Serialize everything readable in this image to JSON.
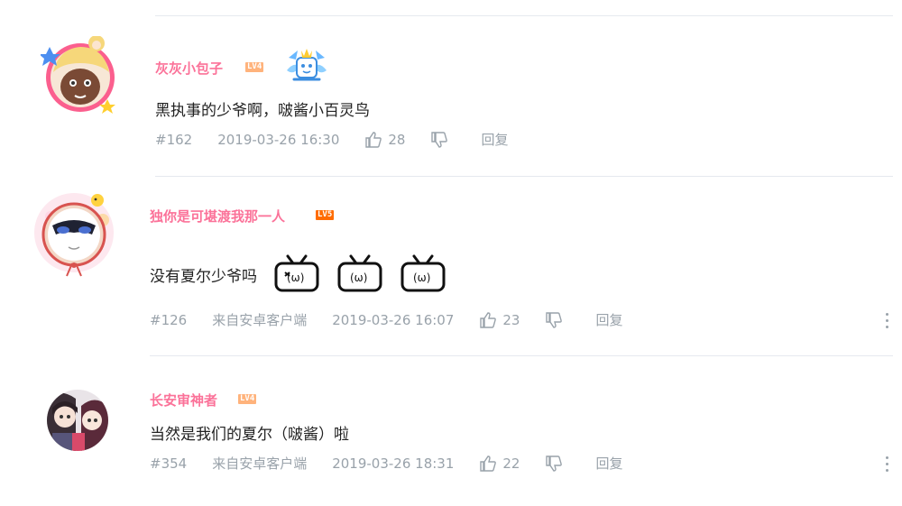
{
  "comments": [
    {
      "username": "灰灰小包子",
      "level": "LV4",
      "text": "黑执事的少爷啊，啵酱小百灵鸟",
      "floor": "#162",
      "device": "",
      "time": "2019-03-26 16:30",
      "likes": "28",
      "reply_label": "回复",
      "has_badge": true
    },
    {
      "username": "独你是可堪渡我那一人",
      "level": "LV5",
      "text": "没有夏尔少爷吗",
      "floor": "#126",
      "device": "来自安卓客户端",
      "time": "2019-03-26 16:07",
      "likes": "23",
      "reply_label": "回复",
      "emotes": [
        "tv-face-emote",
        "tv-face-emote",
        "tv-face-emote"
      ]
    },
    {
      "username": "长安审神者",
      "level": "LV4",
      "text": "当然是我们的夏尔（啵酱）啦",
      "floor": "#354",
      "device": "来自安卓客户端",
      "time": "2019-03-26 18:31",
      "likes": "22",
      "reply_label": "回复"
    }
  ],
  "colors": {
    "username": "#fb7299",
    "meta": "#99a2aa",
    "lv4": "#ffb37c",
    "lv5": "#ff6c00",
    "divider": "#e5e9ef"
  }
}
